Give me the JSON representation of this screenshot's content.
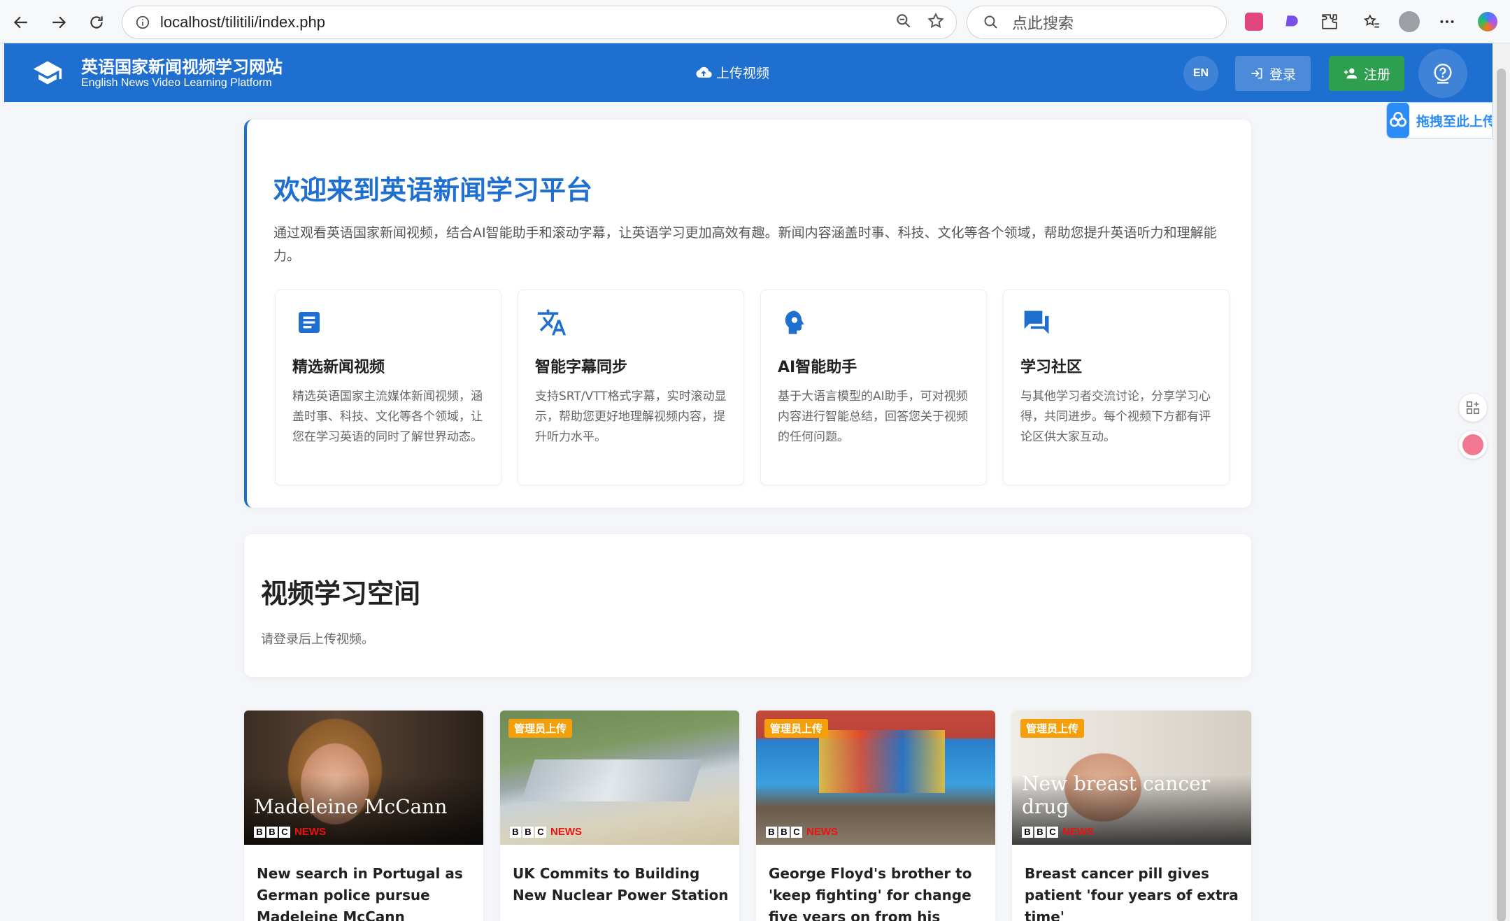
{
  "browser": {
    "url": "localhost/tilitili/index.php",
    "search_placeholder": "点此搜索"
  },
  "header": {
    "title": "英语国家新闻视频学习网站",
    "subtitle": "English News Video Learning Platform",
    "upload_label": "上传视频",
    "lang_label": "EN",
    "login_label": "登录",
    "register_label": "注册",
    "brand_color": "#1f6fd1"
  },
  "side_widget": {
    "drag_label": "拖拽至此上传"
  },
  "welcome": {
    "title": "欢迎来到英语新闻学习平台",
    "description": "通过观看英语国家新闻视频，结合AI智能助手和滚动字幕，让英语学习更加高效有趣。新闻内容涵盖时事、科技、文化等各个领域，帮助您提升英语听力和理解能力。",
    "features": [
      {
        "icon": "article-icon",
        "title": "精选新闻视频",
        "desc": "精选英语国家主流媒体新闻视频，涵盖时事、科技、文化等各个领域，让您在学习英语的同时了解世界动态。"
      },
      {
        "icon": "translate-icon",
        "title": "智能字幕同步",
        "desc": "支持SRT/VTT格式字幕，实时滚动显示，帮助您更好地理解视频内容，提升听力水平。"
      },
      {
        "icon": "ai-assistant-icon",
        "title": "AI智能助手",
        "desc": "基于大语言模型的AI助手，可对视频内容进行智能总结，回答您关于视频的任何问题。"
      },
      {
        "icon": "forum-icon",
        "title": "学习社区",
        "desc": "与其他学习者交流讨论，分享学习心得，共同进步。每个视频下方都有评论区供大家互动。"
      }
    ]
  },
  "video_space": {
    "title": "视频学习空间",
    "note": "请登录后上传视频。"
  },
  "videos": [
    {
      "badge": "",
      "caption": "Madeleine McCann",
      "title": "New search in Portugal as German police pursue Madeleine McCann “murder"
    },
    {
      "badge": "管理员上传",
      "caption": "",
      "title": "UK Commits to Building New Nuclear Power Station"
    },
    {
      "badge": "管理员上传",
      "caption": "",
      "title": "George Floyd's brother to 'keep fighting' for change five years on from his death"
    },
    {
      "badge": "管理员上传",
      "caption": "New breast cancer drug",
      "title": "Breast cancer pill gives patient 'four years of extra time'"
    }
  ],
  "bbc": {
    "letters": [
      "B",
      "B",
      "C"
    ],
    "news": "NEWS"
  }
}
